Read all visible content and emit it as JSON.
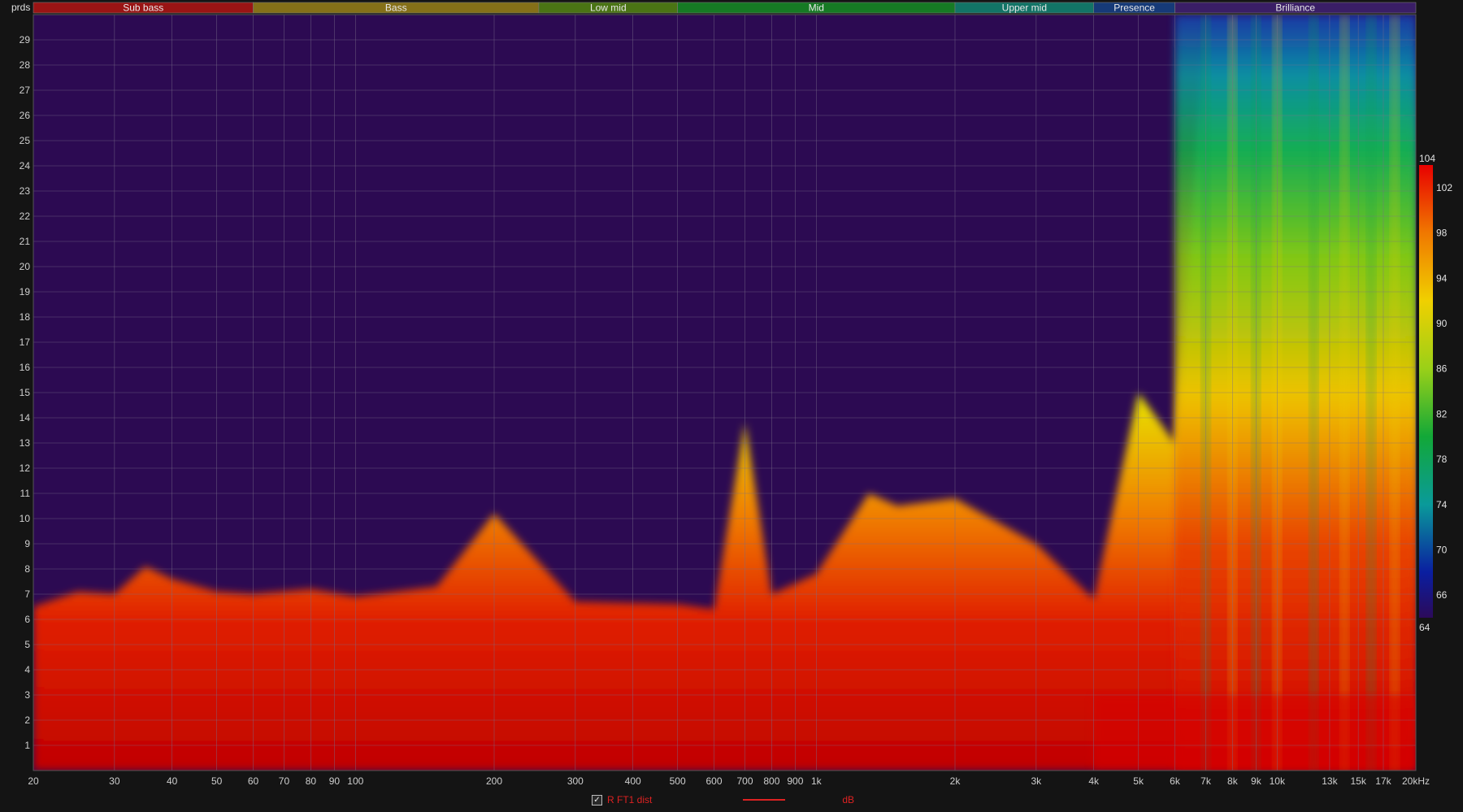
{
  "chart_data": {
    "type": "heatmap",
    "title": "",
    "xlabel": "kHz",
    "ylabel": "prds",
    "x_scale": "log",
    "xlim": [
      20,
      20000
    ],
    "ylim": [
      0,
      30
    ],
    "grid": true,
    "bands": [
      {
        "label": "Sub bass",
        "from": 20,
        "to": 60,
        "color": "#9a1414"
      },
      {
        "label": "Bass",
        "from": 60,
        "to": 250,
        "color": "#857018"
      },
      {
        "label": "Low mid",
        "from": 250,
        "to": 500,
        "color": "#4a7414"
      },
      {
        "label": "Mid",
        "from": 500,
        "to": 2000,
        "color": "#167a24"
      },
      {
        "label": "Upper mid",
        "from": 2000,
        "to": 4000,
        "color": "#127466"
      },
      {
        "label": "Presence",
        "from": 4000,
        "to": 6000,
        "color": "#163a78"
      },
      {
        "label": "Brilliance",
        "from": 6000,
        "to": 20000,
        "color": "#3a1e66"
      }
    ],
    "x_ticks": [
      {
        "v": 20,
        "l": "20"
      },
      {
        "v": 30,
        "l": "30"
      },
      {
        "v": 40,
        "l": "40"
      },
      {
        "v": 50,
        "l": "50"
      },
      {
        "v": 60,
        "l": "60"
      },
      {
        "v": 70,
        "l": "70"
      },
      {
        "v": 80,
        "l": "80"
      },
      {
        "v": 90,
        "l": "90"
      },
      {
        "v": 100,
        "l": "100"
      },
      {
        "v": 200,
        "l": "200"
      },
      {
        "v": 300,
        "l": "300"
      },
      {
        "v": 400,
        "l": "400"
      },
      {
        "v": 500,
        "l": "500"
      },
      {
        "v": 600,
        "l": "600"
      },
      {
        "v": 700,
        "l": "700"
      },
      {
        "v": 800,
        "l": "800"
      },
      {
        "v": 900,
        "l": "900"
      },
      {
        "v": 1000,
        "l": "1k"
      },
      {
        "v": 2000,
        "l": "2k"
      },
      {
        "v": 3000,
        "l": "3k"
      },
      {
        "v": 4000,
        "l": "4k"
      },
      {
        "v": 5000,
        "l": "5k"
      },
      {
        "v": 6000,
        "l": "6k"
      },
      {
        "v": 7000,
        "l": "7k"
      },
      {
        "v": 8000,
        "l": "8k"
      },
      {
        "v": 9000,
        "l": "9k"
      },
      {
        "v": 10000,
        "l": "10k"
      },
      {
        "v": 13000,
        "l": "13k"
      },
      {
        "v": 15000,
        "l": "15k"
      },
      {
        "v": 17000,
        "l": "17k"
      },
      {
        "v": 20000,
        "l": "20kHz"
      }
    ],
    "y_ticks": [
      1,
      2,
      3,
      4,
      5,
      6,
      7,
      8,
      9,
      10,
      11,
      12,
      13,
      14,
      15,
      16,
      17,
      18,
      19,
      20,
      21,
      22,
      23,
      24,
      25,
      26,
      27,
      28,
      29
    ],
    "colorbar": {
      "min": 64,
      "max": 104,
      "ticks": [
        104,
        102,
        98,
        94,
        90,
        86,
        82,
        78,
        74,
        70,
        66,
        64
      ]
    },
    "decay_profile": [
      {
        "freq": 20,
        "periods": 6.5
      },
      {
        "freq": 25,
        "periods": 7.1
      },
      {
        "freq": 30,
        "periods": 7.0
      },
      {
        "freq": 35,
        "periods": 8.1
      },
      {
        "freq": 40,
        "periods": 7.6
      },
      {
        "freq": 50,
        "periods": 7.1
      },
      {
        "freq": 60,
        "periods": 7.0
      },
      {
        "freq": 80,
        "periods": 7.2
      },
      {
        "freq": 100,
        "periods": 6.9
      },
      {
        "freq": 150,
        "periods": 7.3
      },
      {
        "freq": 200,
        "periods": 10.2
      },
      {
        "freq": 300,
        "periods": 6.7
      },
      {
        "freq": 500,
        "periods": 6.6
      },
      {
        "freq": 600,
        "periods": 6.4
      },
      {
        "freq": 700,
        "periods": 13.8
      },
      {
        "freq": 800,
        "periods": 7.0
      },
      {
        "freq": 1000,
        "periods": 7.8
      },
      {
        "freq": 1300,
        "periods": 11.0
      },
      {
        "freq": 1500,
        "periods": 10.5
      },
      {
        "freq": 2000,
        "periods": 10.8
      },
      {
        "freq": 3000,
        "periods": 9.0
      },
      {
        "freq": 4000,
        "periods": 6.8
      },
      {
        "freq": 5000,
        "periods": 15.0
      },
      {
        "freq": 6000,
        "periods": 13.0
      },
      {
        "freq": 7000,
        "periods": 30.0
      },
      {
        "freq": 20000,
        "periods": 30.0
      }
    ]
  },
  "legend": {
    "checked_mark": "✓",
    "trace_label": "R FT1 dist",
    "unit_label": "dB",
    "trace_color": "#dd2222"
  }
}
